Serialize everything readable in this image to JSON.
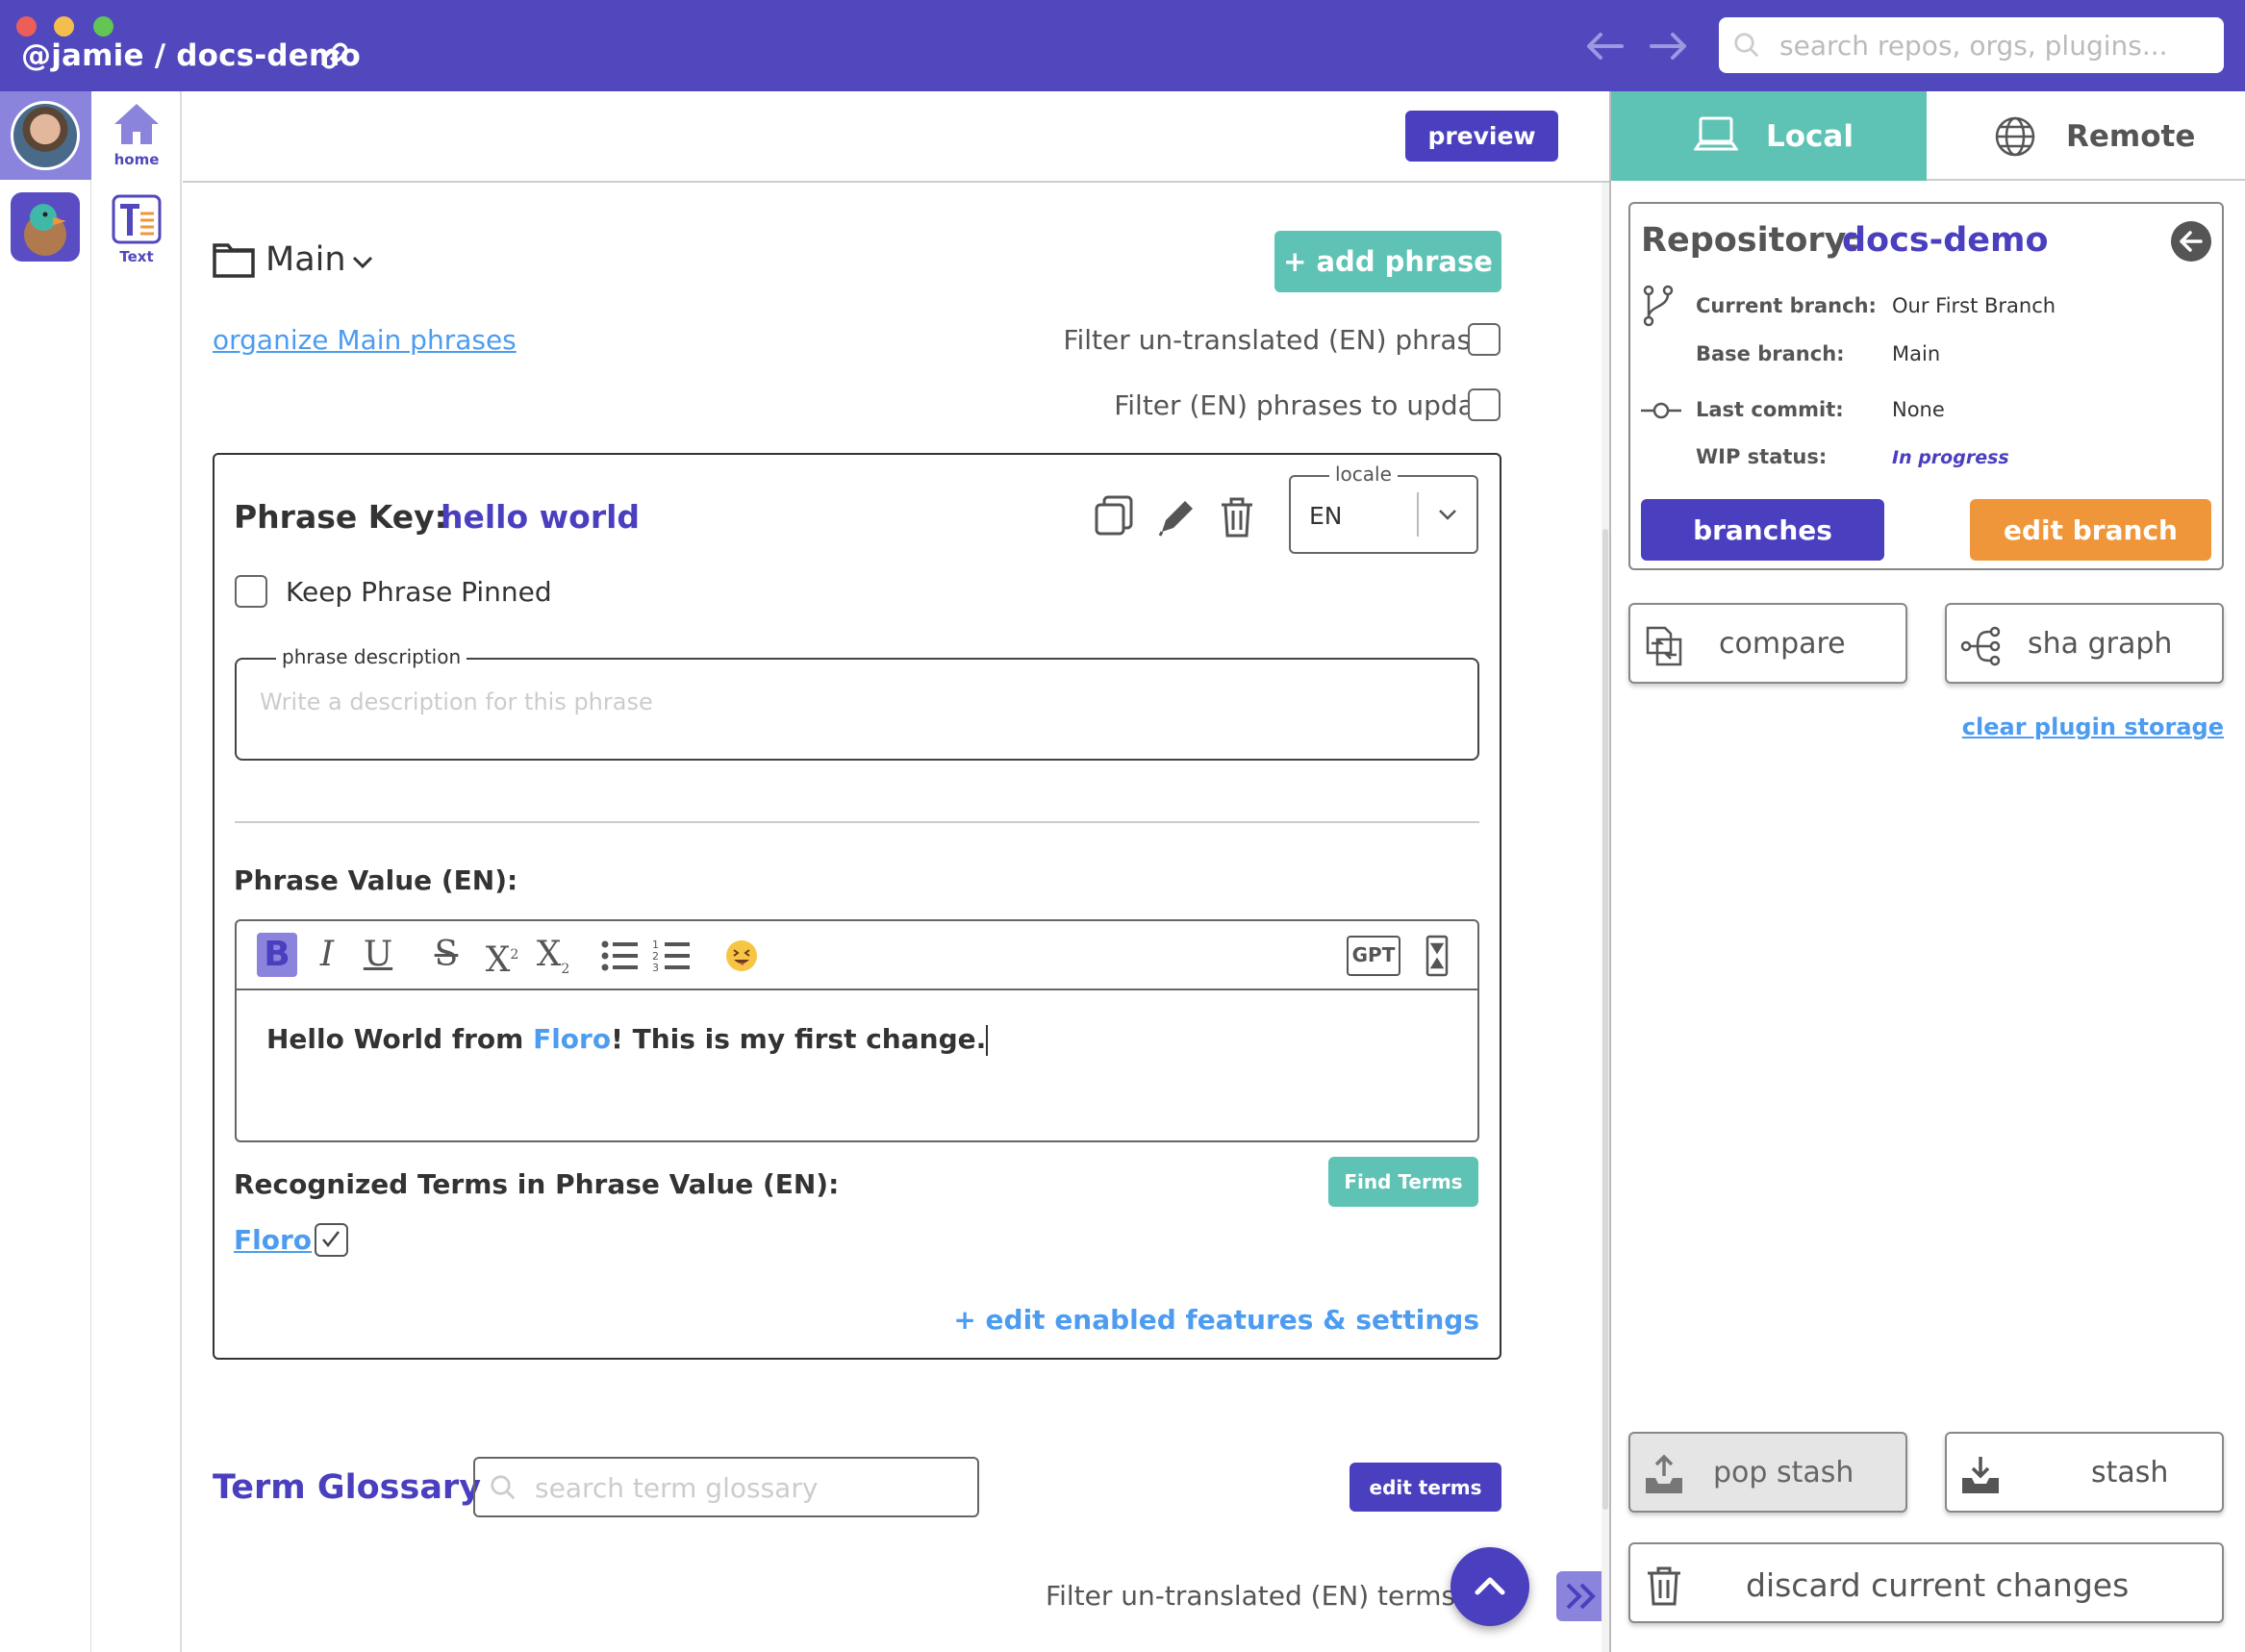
{
  "window": {
    "title": "@jamie / docs-demo",
    "search_placeholder": "search repos, orgs, plugins..."
  },
  "sidebar": {
    "home_label": "home",
    "plugin_label": "Text"
  },
  "toolbar": {
    "preview_label": "preview"
  },
  "main": {
    "group_name": "Main",
    "add_phrase_label": "+ add phrase",
    "organize_link": "organize Main phrases",
    "filter_untranslated": "Filter un-translated (EN) phrases",
    "filter_update": "Filter (EN) phrases to update"
  },
  "phrase": {
    "key_label": "Phrase Key:",
    "key_value": "hello world",
    "locale_legend": "locale",
    "locale_value": "EN",
    "keep_pinned_label": "Keep Phrase Pinned",
    "description_legend": "phrase description",
    "description_placeholder": "Write a description for this phrase",
    "value_label": "Phrase Value (EN):",
    "editor_text_prefix": "Hello World from ",
    "editor_text_term": "Floro",
    "editor_text_suffix": "! This is my first change.",
    "gpt_label": "GPT",
    "recognized_label": "Recognized Terms in Phrase Value (EN):",
    "find_terms_label": "Find Terms",
    "recognized_term": "Floro",
    "edit_features_link": "+ edit enabled features & settings"
  },
  "glossary": {
    "title": "Term Glossary",
    "search_placeholder": "search term glossary",
    "edit_terms_label": "edit terms",
    "filter_terms": "Filter un-translated (EN) terms"
  },
  "right_panel": {
    "tabs": [
      {
        "label": "Local",
        "active": true
      },
      {
        "label": "Remote",
        "active": false
      }
    ],
    "repo_label": "Repository:",
    "repo_name": "docs-demo",
    "current_branch_key": "Current branch:",
    "current_branch_value": "Our First Branch",
    "base_branch_key": "Base branch:",
    "base_branch_value": "Main",
    "last_commit_key": "Last commit:",
    "last_commit_value": "None",
    "wip_key": "WIP status:",
    "wip_value": "In progress",
    "branches_label": "branches",
    "edit_branch_label": "edit branch",
    "compare_label": "compare",
    "sha_graph_label": "sha graph",
    "clear_storage_link": "clear plugin storage",
    "pop_stash_label": "pop stash",
    "stash_label": "stash",
    "discard_label": "discard current changes"
  },
  "colors": {
    "brand_purple": "#5148bd",
    "accent_teal": "#5ec3b5",
    "accent_orange": "#f0963a",
    "link_blue": "#4d9cf0"
  }
}
